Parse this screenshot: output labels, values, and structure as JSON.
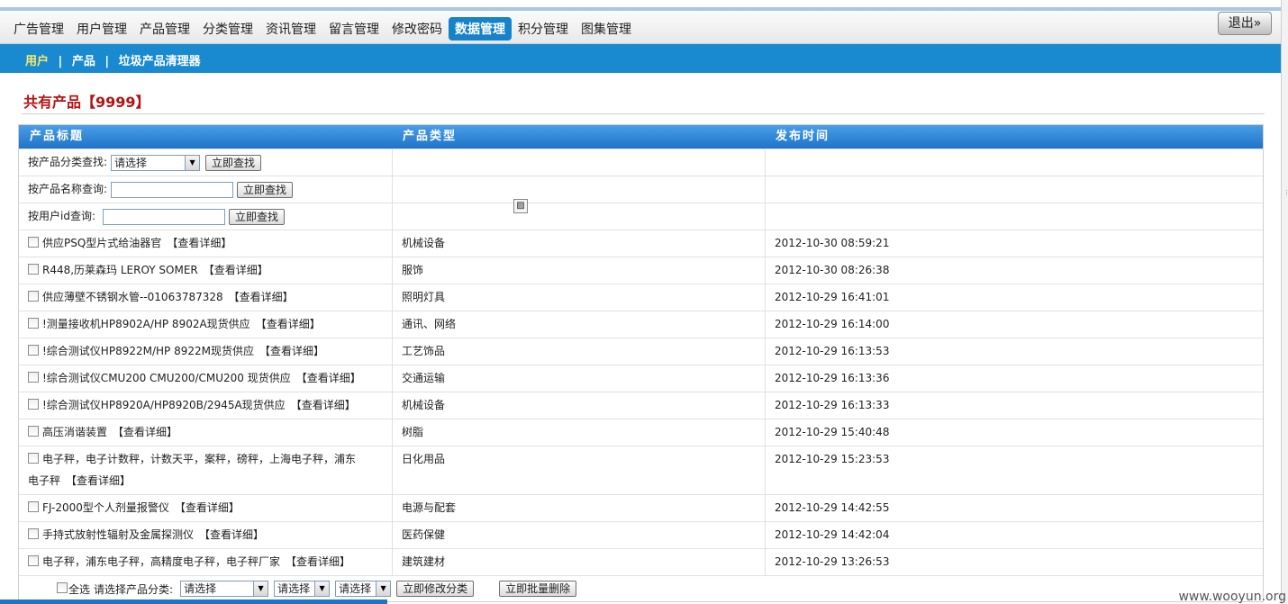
{
  "menu": {
    "items": [
      "广告管理",
      "用户管理",
      "产品管理",
      "分类管理",
      "资讯管理",
      "留言管理",
      "修改密码",
      "数据管理",
      "积分管理",
      "图集管理"
    ],
    "active_index": 7,
    "logout_label": "退出»"
  },
  "subnav": {
    "items": [
      "用户",
      "产品",
      "垃圾产品清理器"
    ],
    "separator": "|"
  },
  "page": {
    "title": "共有产品【9999】"
  },
  "table": {
    "headers": [
      "产品标题",
      "产品类型",
      "发布时间"
    ],
    "detail_label": "【查看详细】",
    "search": {
      "by_category_label": "按产品分类查找:",
      "by_category_select": "请选择",
      "by_name_label": "按产品名称查询:",
      "by_userid_label": "按用户id查询:",
      "search_button": "立即查找"
    },
    "rows": [
      {
        "title": "供应PSQ型片式给油器官",
        "type": "机械设备",
        "time": "2012-10-30 08:59:21"
      },
      {
        "title": "R448,历莱森玛 LEROY SOMER",
        "type": "服饰",
        "time": "2012-10-30 08:26:38"
      },
      {
        "title": "供应薄壁不锈钢水管--01063787328",
        "type": "照明灯具",
        "time": "2012-10-29 16:41:01"
      },
      {
        "title": "!测量接收机HP8902A/HP 8902A现货供应",
        "type": "通讯、网络",
        "time": "2012-10-29 16:14:00"
      },
      {
        "title": "!综合测试仪HP8922M/HP 8922M现货供应",
        "type": "工艺饰品",
        "time": "2012-10-29 16:13:53"
      },
      {
        "title": "!综合测试仪CMU200 CMU200/CMU200 现货供应",
        "type": "交通运输",
        "time": "2012-10-29 16:13:36"
      },
      {
        "title": "!综合测试仪HP8920A/HP8920B/2945A现货供应",
        "type": "机械设备",
        "time": "2012-10-29 16:13:33"
      },
      {
        "title": "高压消谐装置",
        "type": "树脂",
        "time": "2012-10-29 15:40:48"
      },
      {
        "title_line1": "电子秤，电子计数秤，计数天平，案秤，磅秤，上海电子秤，浦东",
        "title_line2": "电子秤",
        "type": "日化用品",
        "time": "2012-10-29 15:23:53"
      },
      {
        "title": "FJ-2000型个人剂量报警仪",
        "type": "电源与配套",
        "time": "2012-10-29 14:42:55"
      },
      {
        "title": "手持式放射性辐射及金属探测仪",
        "type": "医药保健",
        "time": "2012-10-29 14:42:04"
      },
      {
        "title": "电子秤，浦东电子秤，高精度电子秤，电子秤厂家",
        "type": "建筑建材",
        "time": "2012-10-29 13:26:53"
      }
    ]
  },
  "footer": {
    "select_all_label": "全选",
    "choose_category_label": "请选择产品分类:",
    "select1": "请选择",
    "select2": "请选择",
    "select3": "请选择",
    "modify_button": "立即修改分类",
    "batch_delete_button": "立即批量删除"
  },
  "watermark": "www.wooyun.org",
  "colors": {
    "accent": "#1a8ad0",
    "active_menu": "#1683c8",
    "title_red": "#b41414"
  }
}
